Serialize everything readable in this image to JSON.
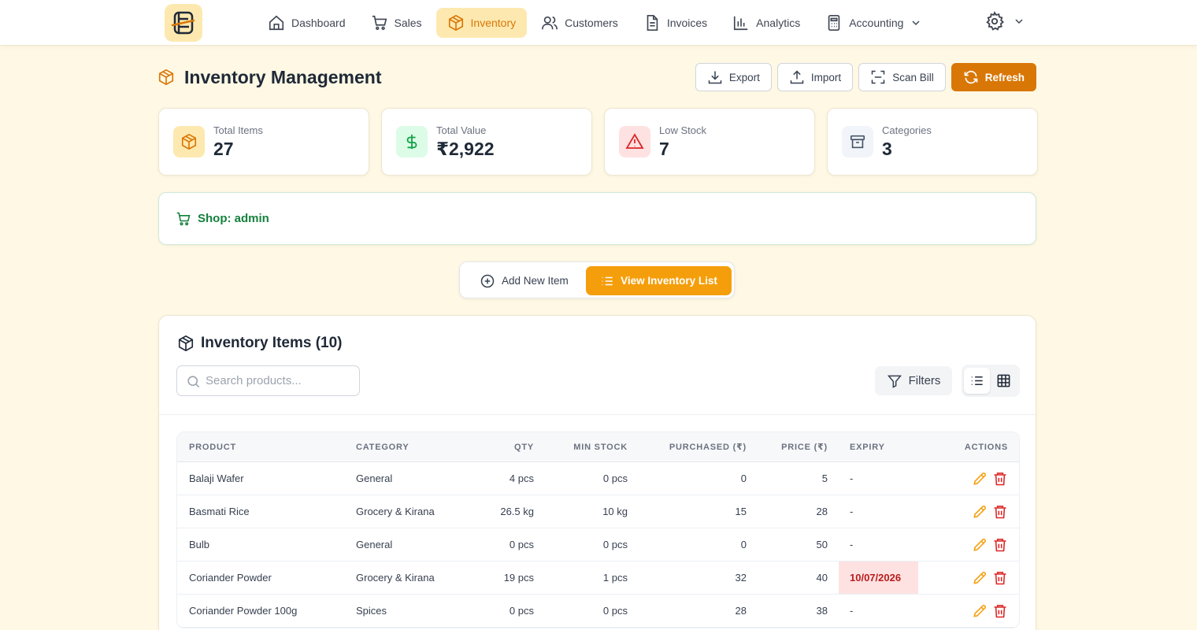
{
  "nav": {
    "items": [
      {
        "label": "Dashboard",
        "icon": "home-icon"
      },
      {
        "label": "Sales",
        "icon": "cart-icon"
      },
      {
        "label": "Inventory",
        "icon": "package-icon",
        "active": true
      },
      {
        "label": "Customers",
        "icon": "users-icon"
      },
      {
        "label": "Invoices",
        "icon": "file-icon"
      },
      {
        "label": "Analytics",
        "icon": "bar-chart-icon"
      },
      {
        "label": "Accounting",
        "icon": "calculator-icon",
        "has_dropdown": true
      }
    ],
    "settings_icon": "gear-icon"
  },
  "page": {
    "title": "Inventory Management",
    "actions": {
      "export": "Export",
      "import": "Import",
      "scan": "Scan Bill",
      "refresh": "Refresh"
    }
  },
  "stats": [
    {
      "label": "Total Items",
      "value": "27",
      "icon": "package-icon",
      "color": "#f59e0b"
    },
    {
      "label": "Total Value",
      "value": "₹2,922",
      "icon": "dollar-icon",
      "color": "#16a34a"
    },
    {
      "label": "Low Stock",
      "value": "7",
      "icon": "alert-triangle-icon",
      "color": "#dc2626"
    },
    {
      "label": "Categories",
      "value": "3",
      "icon": "archive-icon",
      "color": "#64748b"
    }
  ],
  "shop": {
    "label": "Shop: admin",
    "icon": "cart-icon"
  },
  "mode": {
    "add": "Add New Item",
    "view": "View Inventory List",
    "active": "view"
  },
  "inventory": {
    "title": "Inventory Items (10)",
    "search_placeholder": "Search products...",
    "filters_label": "Filters",
    "columns": {
      "product": "PRODUCT",
      "category": "CATEGORY",
      "qty": "QTY",
      "min_stock": "MIN STOCK",
      "purchased": "PURCHASED (₹)",
      "price": "PRICE (₹)",
      "expiry": "EXPIRY",
      "actions": "ACTIONS"
    },
    "rows": [
      {
        "product": "Balaji Wafer",
        "category": "General",
        "qty": "4 pcs",
        "min_stock": "0 pcs",
        "purchased": "0",
        "price": "5",
        "expiry": "-",
        "expiry_warning": false
      },
      {
        "product": "Basmati Rice",
        "category": "Grocery & Kirana",
        "qty": "26.5 kg",
        "min_stock": "10 kg",
        "purchased": "15",
        "price": "28",
        "expiry": "-",
        "expiry_warning": false
      },
      {
        "product": "Bulb",
        "category": "General",
        "qty": "0 pcs",
        "min_stock": "0 pcs",
        "purchased": "0",
        "price": "50",
        "expiry": "-",
        "expiry_warning": false
      },
      {
        "product": "Coriander Powder",
        "category": "Grocery & Kirana",
        "qty": "19 pcs",
        "min_stock": "1 pcs",
        "purchased": "32",
        "price": "40",
        "expiry": "10/07/2026",
        "expiry_warning": true
      },
      {
        "product": "Coriander Powder 100g",
        "category": "Spices",
        "qty": "0 pcs",
        "min_stock": "0 pcs",
        "purchased": "28",
        "price": "38",
        "expiry": "-",
        "expiry_warning": false
      }
    ]
  },
  "colors": {
    "accent": "#f59e0b",
    "accent_dark": "#d97706",
    "background": "#fef8e4",
    "danger": "#dc2626",
    "success": "#15803d"
  }
}
